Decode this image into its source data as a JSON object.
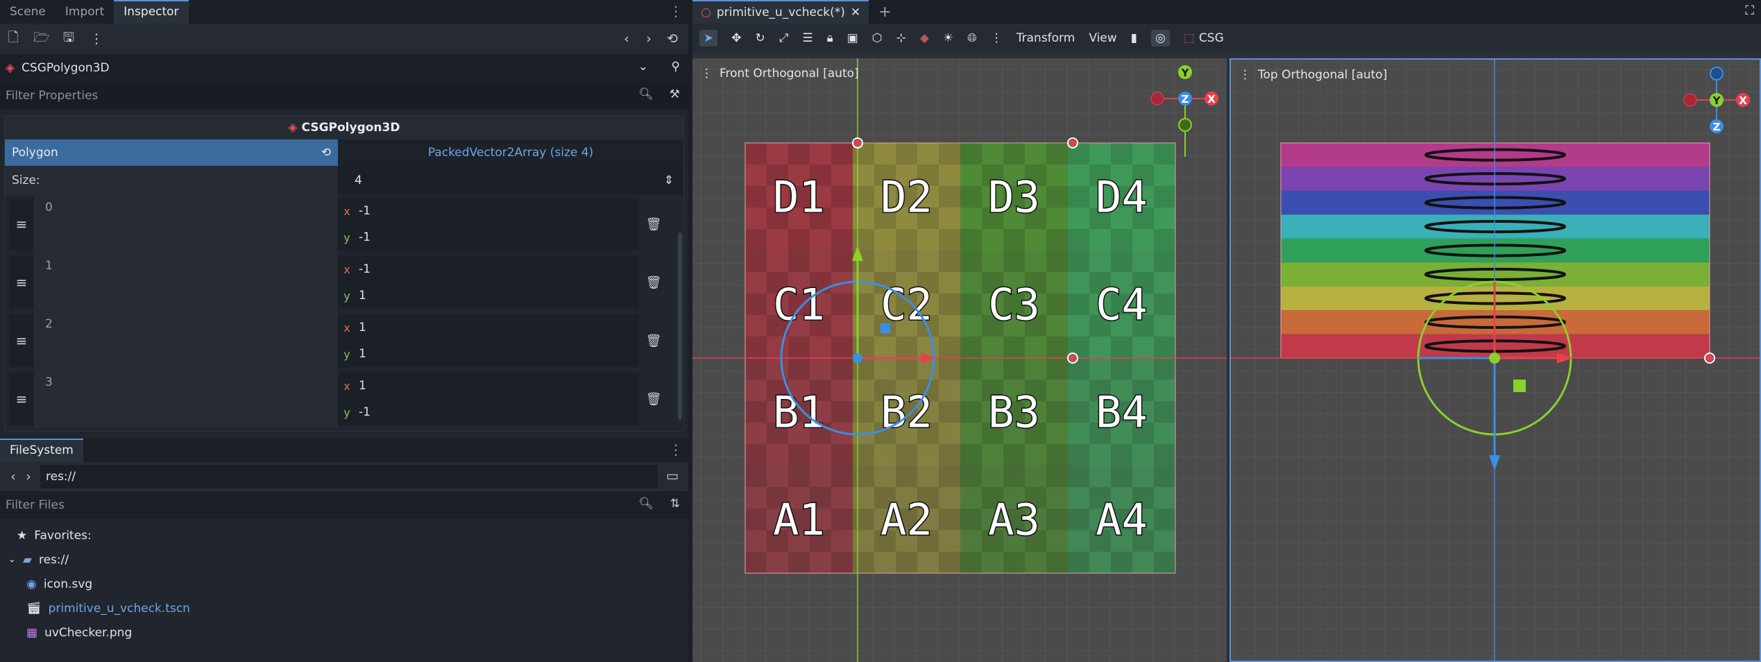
{
  "dock_tabs": [
    "Scene",
    "Import",
    "Inspector"
  ],
  "inspector": {
    "node_type": "CSGPolygon3D",
    "filter_placeholder": "Filter Properties",
    "section_title": "CSGPolygon3D",
    "polygon_label": "Polygon",
    "polygon_value": "PackedVector2Array (size 4)",
    "size_label": "Size:",
    "size_value": "4",
    "elements": [
      {
        "index": "0",
        "x": "-1",
        "y": "-1"
      },
      {
        "index": "1",
        "x": "-1",
        "y": "1"
      },
      {
        "index": "2",
        "x": "1",
        "y": "1"
      },
      {
        "index": "3",
        "x": "1",
        "y": "-1"
      }
    ],
    "x_axis": "x",
    "y_axis": "y"
  },
  "filesystem": {
    "tab": "FileSystem",
    "path": "res://",
    "filter_placeholder": "Filter Files",
    "favorites": "Favorites:",
    "root": "res://",
    "files": [
      "icon.svg",
      "primitive_u_vcheck.tscn",
      "uvChecker.png"
    ]
  },
  "scene_tab": {
    "title": "primitive_u_vcheck(*)",
    "add": "+"
  },
  "toolbar": {
    "transform": "Transform",
    "view": "View",
    "csg": "CSG"
  },
  "viewports": {
    "front_label": "Front Orthogonal [auto]",
    "top_label": "Top Orthogonal [auto]",
    "grid_rows": [
      "D",
      "C",
      "B",
      "A"
    ],
    "grid_cols": [
      "1",
      "2",
      "3",
      "4"
    ],
    "gizmo_y": "Y",
    "gizmo_z": "Z",
    "gizmo_x": "X"
  },
  "colors": {
    "accent": "#5c93d6",
    "selected_prop": "#3b6a9c",
    "axis_x": "#e8414e",
    "axis_y": "#8ad12b",
    "axis_z": "#3b8ee8"
  }
}
